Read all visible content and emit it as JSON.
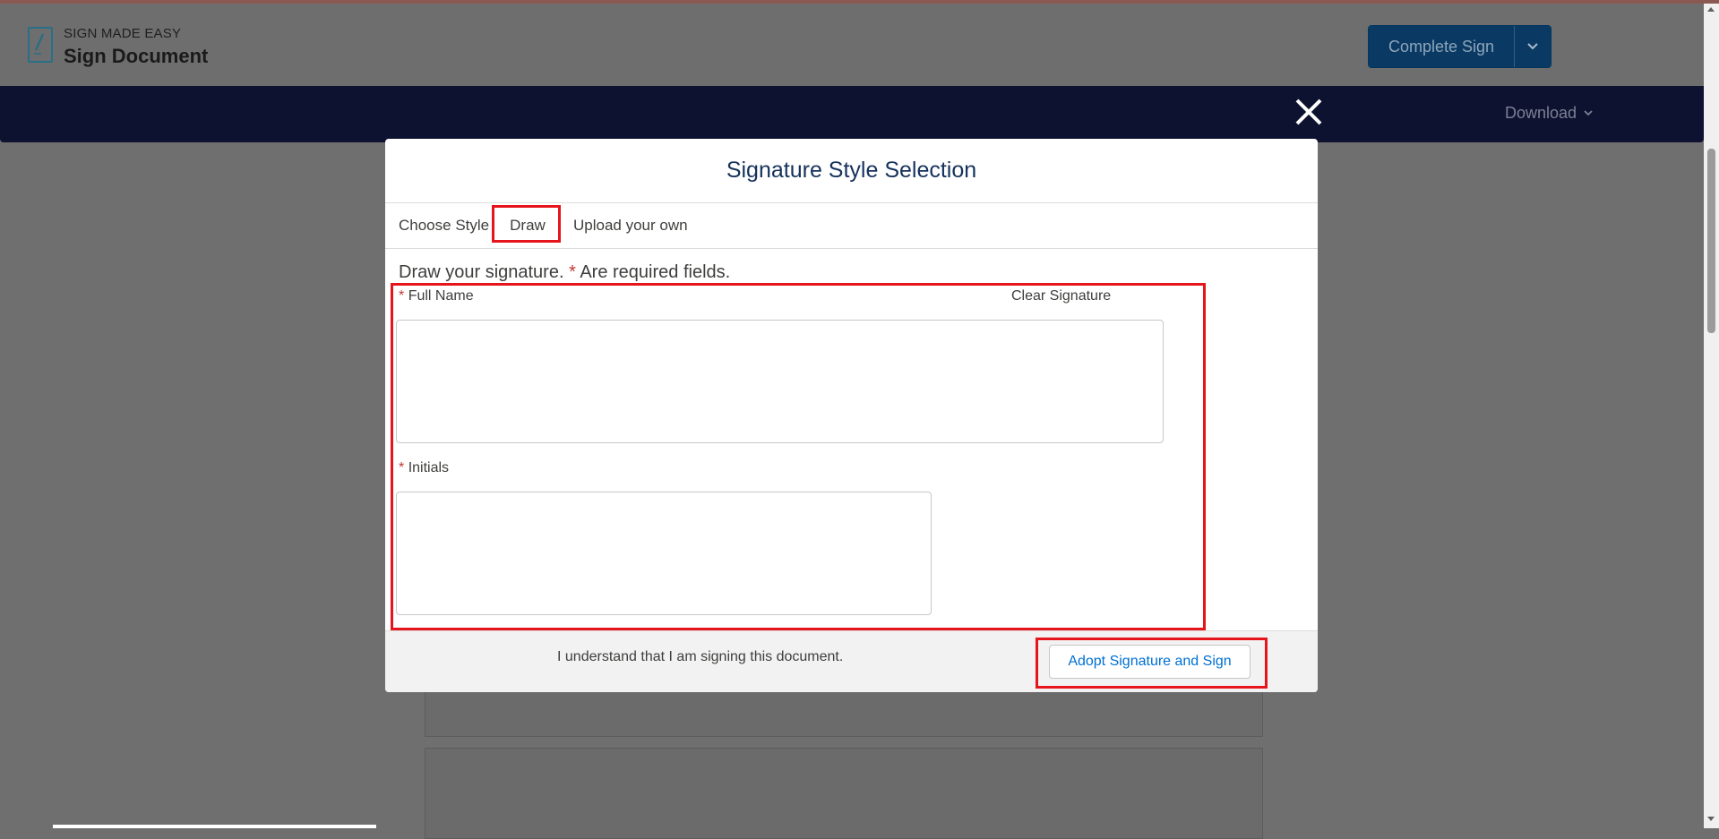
{
  "header": {
    "brand_sub": "SIGN MADE EASY",
    "brand_title": "Sign Document",
    "complete_label": "Complete Sign",
    "download_label": "Download"
  },
  "modal": {
    "title": "Signature Style Selection",
    "tabs": [
      {
        "label": "Choose Style"
      },
      {
        "label": "Draw"
      },
      {
        "label": "Upload your own"
      }
    ],
    "instructions_prefix": "Draw your signature.",
    "required_marker": "*",
    "instructions_suffix": "Are required fields.",
    "full_name_label": "Full Name",
    "clear_signature_label": "Clear Signature",
    "initials_label": "Initials",
    "understand_text": "I understand that I am signing this document.",
    "adopt_label": "Adopt Signature and Sign"
  },
  "colors": {
    "overlay": "#6f6f6f",
    "navy_band": "#0c1230",
    "primary_button": "#0a3a63",
    "link_blue": "#0070d2",
    "highlight_red": "#e5151b",
    "required_red": "#c23934"
  }
}
